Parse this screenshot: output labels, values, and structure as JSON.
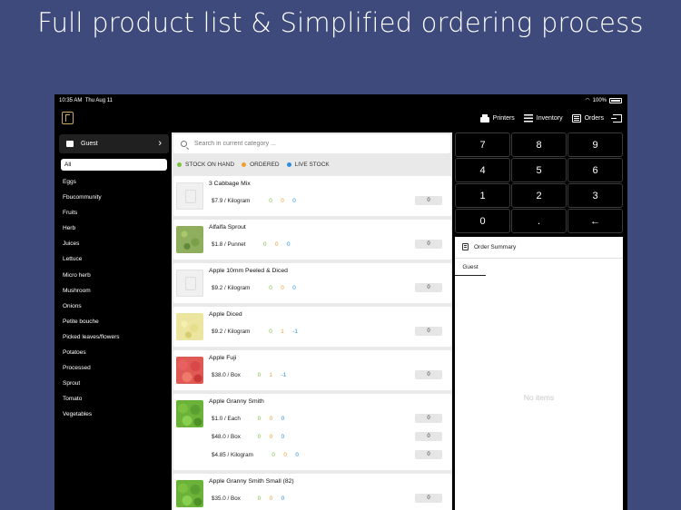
{
  "headline": "Full product list & Simplified ordering process",
  "status": {
    "time": "10:35 AM",
    "date": "Thu Aug 11",
    "battery": "100%"
  },
  "nav": {
    "printers": "Printers",
    "inventory": "Inventory",
    "orders": "Orders"
  },
  "sidebar": {
    "guest_label": "Guest",
    "categories": [
      "All",
      "Eggs",
      "Fbucommunity",
      "Fruits",
      "Herb",
      "Juices",
      "Lettuce",
      "Micro herb",
      "Mushroom",
      "Onions",
      "Petite bouche",
      "Picked leaves/flowers",
      "Potatoes",
      "Processed",
      "Sprout",
      "Tomato",
      "Vegetables"
    ]
  },
  "search": {
    "placeholder": "Search in current category ..."
  },
  "legend": {
    "stock_on_hand": "STOCK ON HAND",
    "ordered": "ORDERED",
    "live_stock": "LIVE STOCK"
  },
  "colors": {
    "stock_on_hand": "#7cc040",
    "ordered": "#f0a030",
    "live_stock": "#2a8fe0",
    "background": "#3f4a7c"
  },
  "products": [
    {
      "name": "3 Cabbage Mix",
      "image": "placeholder-icon",
      "variants": [
        {
          "price": "$7.9 / Kilogram",
          "on_hand": "0",
          "ordered": "0",
          "live": "0",
          "qty": "0"
        }
      ]
    },
    {
      "name": "Alfalfa Sprout",
      "image": "sprout-photo",
      "variants": [
        {
          "price": "$1.8 / Punnet",
          "on_hand": "0",
          "ordered": "0",
          "live": "0",
          "qty": "0"
        }
      ]
    },
    {
      "name": "Apple 10mm Peeled & Diced",
      "image": "placeholder-icon",
      "variants": [
        {
          "price": "$9.2 / Kilogram",
          "on_hand": "0",
          "ordered": "0",
          "live": "0",
          "qty": "0"
        }
      ]
    },
    {
      "name": "Apple Diced",
      "image": "diced-apple-photo",
      "variants": [
        {
          "price": "$9.2 / Kilogram",
          "on_hand": "0",
          "ordered": "1",
          "live": "-1",
          "qty": "0"
        }
      ]
    },
    {
      "name": "Apple Fuji",
      "image": "fuji-apple-photo",
      "variants": [
        {
          "price": "$38.0 / Box",
          "on_hand": "0",
          "ordered": "1",
          "live": "-1",
          "qty": "0"
        }
      ]
    },
    {
      "name": "Apple Granny Smith",
      "image": "granny-apple-photo",
      "variants": [
        {
          "price": "$1.0 / Each",
          "on_hand": "0",
          "ordered": "0",
          "live": "0",
          "qty": "0"
        },
        {
          "price": "$48.0 / Box",
          "on_hand": "0",
          "ordered": "0",
          "live": "0",
          "qty": "0"
        },
        {
          "price": "$4.85 / Kilogram",
          "on_hand": "0",
          "ordered": "0",
          "live": "0",
          "qty": "0"
        }
      ]
    },
    {
      "name": "Apple Granny Smith Small (82)",
      "image": "granny-apple-photo",
      "variants": [
        {
          "price": "$35.0 / Box",
          "on_hand": "0",
          "ordered": "0",
          "live": "0",
          "qty": "0"
        }
      ]
    }
  ],
  "keypad": [
    "7",
    "8",
    "9",
    "4",
    "5",
    "6",
    "1",
    "2",
    "3",
    "0",
    ".",
    "←"
  ],
  "order_summary": {
    "title": "Order Summary",
    "tab": "Guest",
    "empty": "No items"
  }
}
